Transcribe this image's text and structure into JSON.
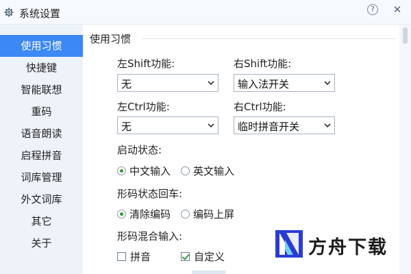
{
  "window": {
    "title": "系统设置",
    "icons": {
      "app": "gear-icon",
      "help": "help-icon",
      "close": "close-icon"
    },
    "help_glyph": "?",
    "close_glyph": "✕"
  },
  "sidebar": {
    "accent": "#3c88f5",
    "background": "#eef3fa",
    "items": [
      {
        "label": "使用习惯",
        "active": true
      },
      {
        "label": "快捷键"
      },
      {
        "label": "智能联想"
      },
      {
        "label": "重码"
      },
      {
        "label": "语音朗读"
      },
      {
        "label": "启程拼音"
      },
      {
        "label": "词库管理"
      },
      {
        "label": "外文词库"
      },
      {
        "label": "其它"
      },
      {
        "label": "关于"
      }
    ]
  },
  "main": {
    "section_title": "使用习惯",
    "left_shift": {
      "label": "左Shift功能:",
      "value": "无"
    },
    "right_shift": {
      "label": "右Shift功能:",
      "value": "输入法开关"
    },
    "left_ctrl": {
      "label": "左Ctrl功能:",
      "value": "无"
    },
    "right_ctrl": {
      "label": "右Ctrl功能:",
      "value": "临时拼音开关"
    },
    "startup_state": {
      "label": "启动状态:",
      "options": [
        {
          "label": "中文输入",
          "selected": true
        },
        {
          "label": "英文输入",
          "selected": false
        }
      ]
    },
    "shape_enter": {
      "label": "形码状态回车:",
      "options": [
        {
          "label": "清除编码",
          "selected": true
        },
        {
          "label": "编码上屏",
          "selected": false
        }
      ]
    },
    "shape_mixed": {
      "label": "形码混合输入:",
      "options": [
        {
          "label": "拼音",
          "checked": false
        },
        {
          "label": "自定义",
          "checked": true
        }
      ]
    }
  },
  "watermark": {
    "text": "方舟下载",
    "accent": "#2b3bd6"
  },
  "colors": {
    "radio_dot": "#2f9e3c",
    "check_mark": "#2f9e3c"
  }
}
